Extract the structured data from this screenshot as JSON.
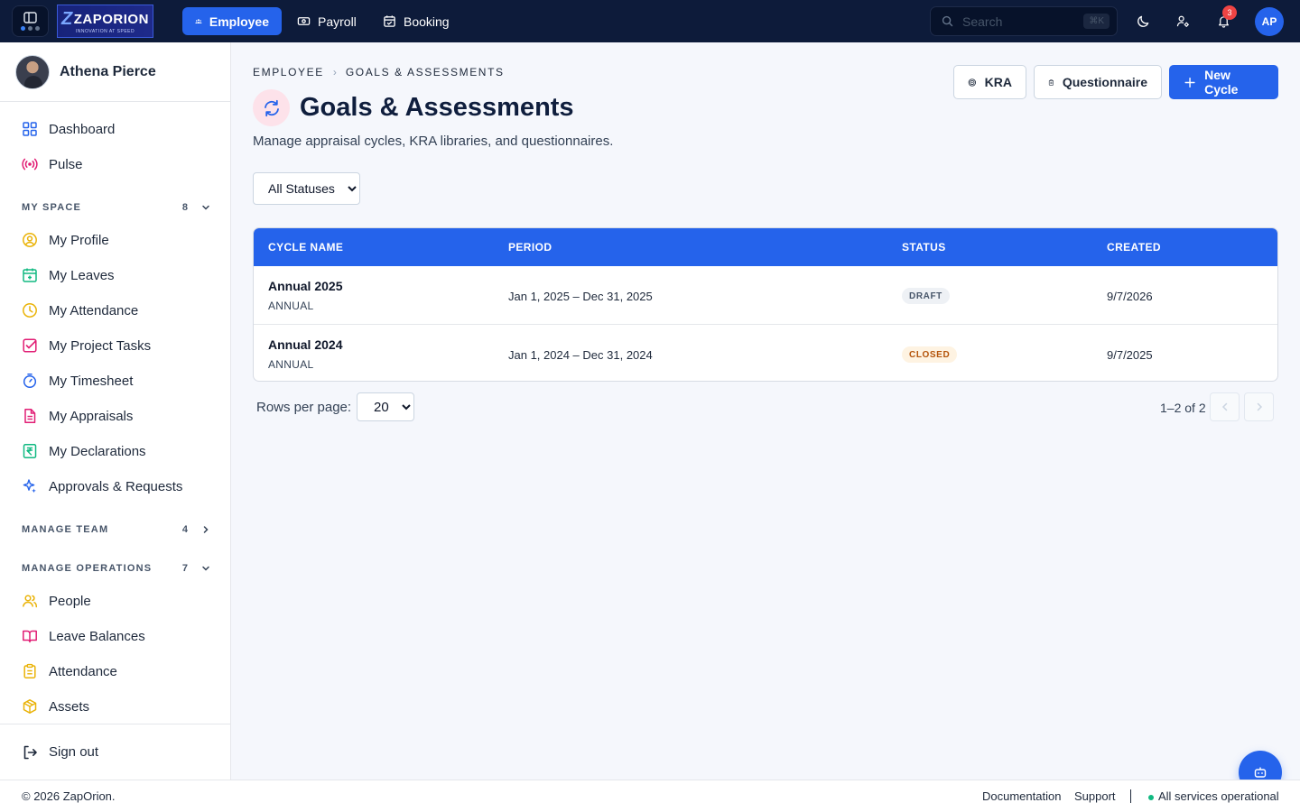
{
  "topbar": {
    "logo": {
      "brand": "ZAPORION",
      "tagline": "INNOVATION AT SPEED"
    },
    "tabs": [
      {
        "label": "Employee",
        "icon": "people-icon",
        "active": true
      },
      {
        "label": "Payroll",
        "icon": "banknote-icon",
        "active": false
      },
      {
        "label": "Booking",
        "icon": "calendar-check-icon",
        "active": false
      }
    ],
    "search_placeholder": "Search",
    "search_shortcut": "⌘K",
    "notification_count": "3",
    "avatar_initials": "AP"
  },
  "sidebar": {
    "user_name": "Athena Pierce",
    "top_items": [
      {
        "label": "Dashboard",
        "icon": "dashboard-icon"
      },
      {
        "label": "Pulse",
        "icon": "broadcast-icon"
      }
    ],
    "sections": [
      {
        "title": "MY SPACE",
        "count": "8",
        "expanded": true
      },
      {
        "title": "MANAGE TEAM",
        "count": "4",
        "expanded": false
      },
      {
        "title": "MANAGE OPERATIONS",
        "count": "7",
        "expanded": true
      }
    ],
    "my_space_items": [
      {
        "label": "My Profile",
        "icon": "user-circle-icon"
      },
      {
        "label": "My Leaves",
        "icon": "calendar-plus-icon"
      },
      {
        "label": "My Attendance",
        "icon": "clock-icon"
      },
      {
        "label": "My Project Tasks",
        "icon": "checkbox-icon"
      },
      {
        "label": "My Timesheet",
        "icon": "timer-icon"
      },
      {
        "label": "My Appraisals",
        "icon": "document-icon"
      },
      {
        "label": "My Declarations",
        "icon": "rupee-receipt-icon"
      },
      {
        "label": "Approvals & Requests",
        "icon": "sparkles-icon"
      }
    ],
    "operations_items": [
      {
        "label": "People",
        "icon": "users-icon"
      },
      {
        "label": "Leave Balances",
        "icon": "book-icon"
      },
      {
        "label": "Attendance",
        "icon": "clipboard-icon"
      },
      {
        "label": "Assets",
        "icon": "package-icon"
      }
    ],
    "sign_out": "Sign out"
  },
  "main": {
    "breadcrumb": [
      "EMPLOYEE",
      "GOALS & ASSESSMENTS"
    ],
    "title": "Goals & Assessments",
    "subtitle": "Manage appraisal cycles, KRA libraries, and questionnaires.",
    "actions": {
      "kra": "KRA",
      "questionnaire": "Questionnaire",
      "new_cycle": "New Cycle"
    },
    "status_filter": {
      "selected": "All Statuses"
    },
    "table": {
      "columns": [
        "CYCLE NAME",
        "PERIOD",
        "STATUS",
        "CREATED"
      ],
      "rows": [
        {
          "name": "Annual 2025",
          "type": "ANNUAL",
          "period": "Jan 1, 2025 – Dec 31, 2025",
          "status": "DRAFT",
          "created": "9/7/2026"
        },
        {
          "name": "Annual 2024",
          "type": "ANNUAL",
          "period": "Jan 1, 2024 – Dec 31, 2024",
          "status": "CLOSED",
          "created": "9/7/2025"
        }
      ]
    },
    "pagination": {
      "rows_per_page_label": "Rows per page:",
      "rows_per_page": "20",
      "range": "1–2 of 2"
    }
  },
  "footer": {
    "copyright": "© 2026 ZapOrion.",
    "links": [
      "Documentation",
      "Support"
    ],
    "status": "All services operational"
  },
  "colors": {
    "accent": "#2563eb",
    "topbar": "#0d1b3a",
    "success": "#10b981"
  }
}
